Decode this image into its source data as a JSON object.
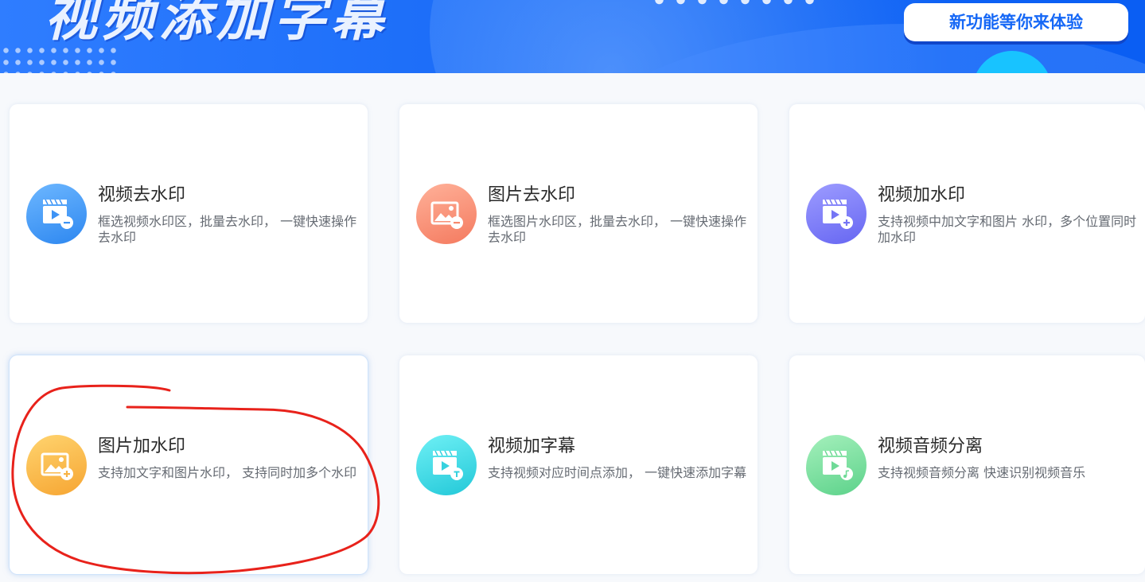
{
  "banner": {
    "title": "视频添加字幕",
    "cta_label": "新功能等你来体验"
  },
  "cards": [
    {
      "title": "视频去水印",
      "desc": "框选视频水印区，批量去水印， 一键快速操作去水印",
      "icon": "video-remove-watermark-icon",
      "color": "#3d93f5"
    },
    {
      "title": "图片去水印",
      "desc": "框选图片水印区，批量去水印， 一键快速操作去水印",
      "icon": "image-remove-watermark-icon",
      "color": "#f7896c"
    },
    {
      "title": "视频加水印",
      "desc": "支持视频中加文字和图片 水印，多个位置同时加水印",
      "icon": "video-add-watermark-icon",
      "color": "#7575f5"
    },
    {
      "title": "图片加水印",
      "desc": "支持加文字和图片水印， 支持同时加多个水印",
      "icon": "image-add-watermark-icon",
      "color": "#f8b446"
    },
    {
      "title": "视频加字幕",
      "desc": "支持视频对应时间点添加， 一键快速添加字幕",
      "icon": "video-add-subtitle-icon",
      "color": "#36d2df"
    },
    {
      "title": "视频音频分离",
      "desc": "支持视频音频分离 快速识别视频音乐",
      "icon": "video-audio-separate-icon",
      "color": "#6fda97"
    }
  ],
  "annotation": {
    "color": "#e8221b"
  }
}
